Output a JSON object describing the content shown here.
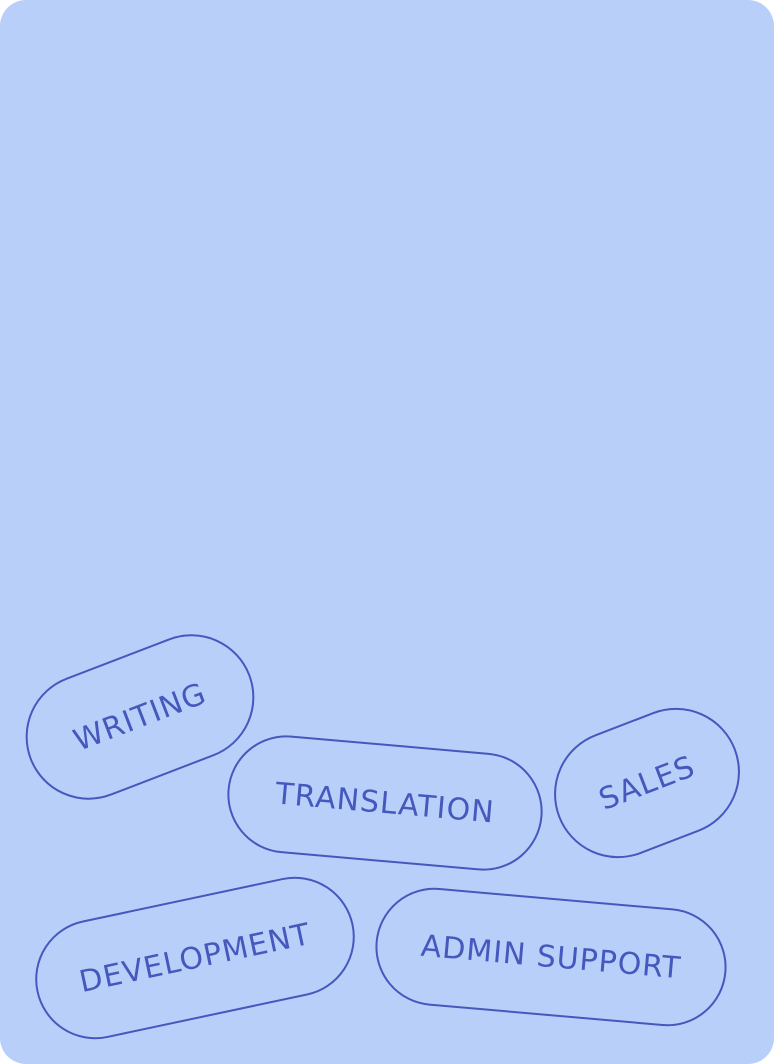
{
  "background_color": "#b8d0f9",
  "accent_color": "#4458bd",
  "tags": [
    {
      "label": "WRITING"
    },
    {
      "label": "TRANSLATION"
    },
    {
      "label": "SALES"
    },
    {
      "label": "DEVELOPMENT"
    },
    {
      "label": "ADMIN SUPPORT"
    }
  ]
}
